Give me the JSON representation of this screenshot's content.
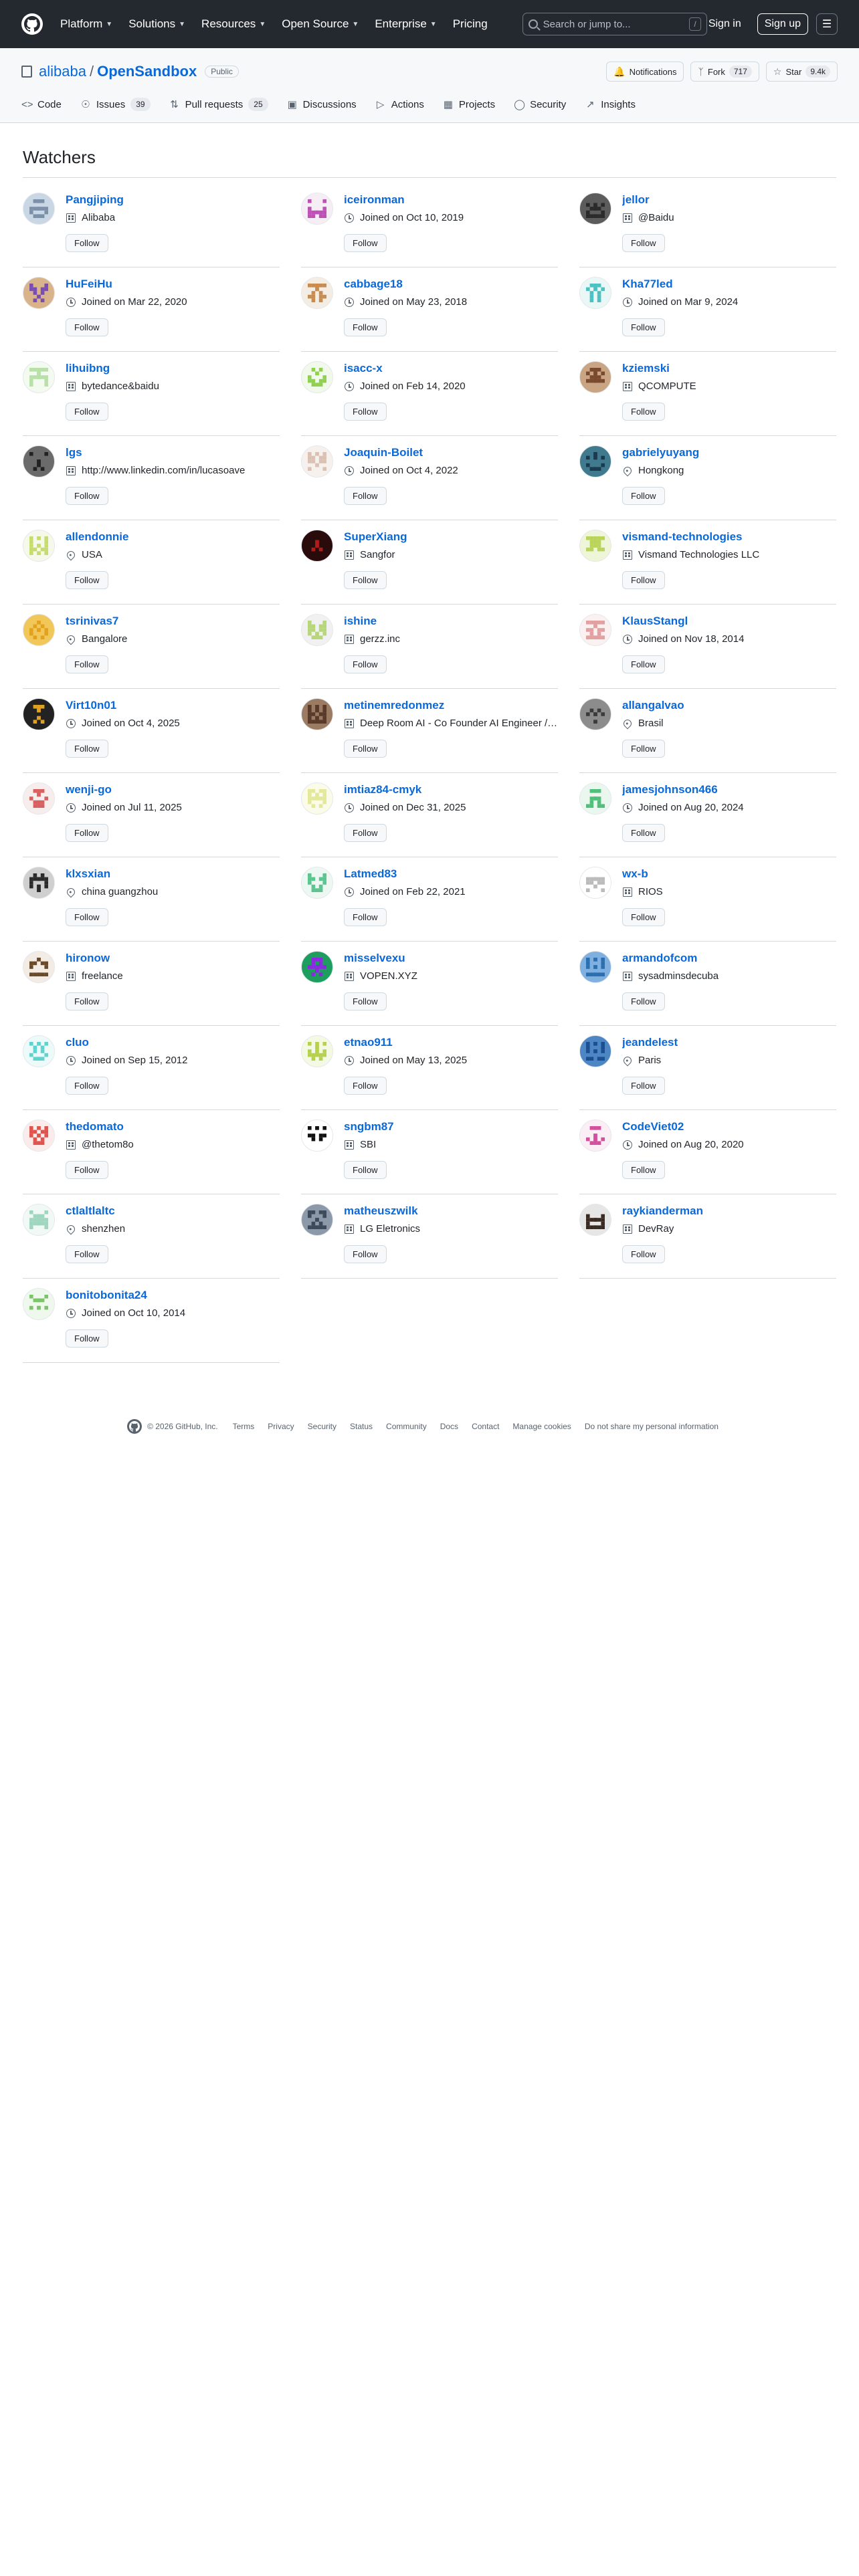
{
  "topnav": {
    "items": [
      "Platform",
      "Solutions",
      "Resources",
      "Open Source",
      "Enterprise",
      "Pricing"
    ],
    "search_placeholder": "Search or jump to...",
    "search_shortcut": "/",
    "signin": "Sign in",
    "signup": "Sign up"
  },
  "repo": {
    "owner": "alibaba",
    "separator": "/",
    "name": "OpenSandbox",
    "visibility": "Public",
    "notifications_label": "Notifications",
    "fork_label": "Fork",
    "fork_count": "717",
    "star_label": "Star",
    "star_count": "9.4k",
    "tabs": [
      {
        "label": "Code",
        "count": ""
      },
      {
        "label": "Issues",
        "count": "39"
      },
      {
        "label": "Pull requests",
        "count": "25"
      },
      {
        "label": "Discussions",
        "count": ""
      },
      {
        "label": "Actions",
        "count": ""
      },
      {
        "label": "Projects",
        "count": ""
      },
      {
        "label": "Security",
        "count": ""
      },
      {
        "label": "Insights",
        "count": ""
      }
    ]
  },
  "page": {
    "title": "Watchers",
    "follow_label": "Follow"
  },
  "watchers": [
    {
      "name": "Pangjiping",
      "meta_type": "org",
      "meta": "Alibaba",
      "color": "#7b8fa8",
      "bg": "#c9d6e4"
    },
    {
      "name": "iceironman",
      "meta_type": "clock",
      "meta": "Joined on Oct 10, 2019",
      "color": "#c04fb8",
      "bg": "#f6eef5"
    },
    {
      "name": "jellor",
      "meta_type": "org",
      "meta": "@Baidu",
      "color": "#2b2b2b",
      "bg": "#5c5c5c"
    },
    {
      "name": "HuFeiHu",
      "meta_type": "clock",
      "meta": "Joined on Mar 22, 2020",
      "color": "#7a4db0",
      "bg": "#d9b48a"
    },
    {
      "name": "cabbage18",
      "meta_type": "clock",
      "meta": "Joined on May 23, 2018",
      "color": "#c98c50",
      "bg": "#f4ede4"
    },
    {
      "name": "Kha77led",
      "meta_type": "clock",
      "meta": "Joined on Mar 9, 2024",
      "color": "#4cc1c1",
      "bg": "#eaf7f7"
    },
    {
      "name": "lihuibng",
      "meta_type": "org",
      "meta": "bytedance&baidu",
      "color": "#b8e0a8",
      "bg": "#f3faf0"
    },
    {
      "name": "isacc-x",
      "meta_type": "clock",
      "meta": "Joined on Feb 14, 2020",
      "color": "#8fd14f",
      "bg": "#f1f9ea"
    },
    {
      "name": "kziemski",
      "meta_type": "org",
      "meta": "QCOMPUTE",
      "color": "#7a4a2e",
      "bg": "#c9a583"
    },
    {
      "name": "lgs",
      "meta_type": "org",
      "meta": "http://www.linkedin.com/in/lucasoave",
      "color": "#222222",
      "bg": "#6b6b6b"
    },
    {
      "name": "Joaquin-Boilet",
      "meta_type": "clock",
      "meta": "Joined on Oct 4, 2022",
      "color": "#d9c2b4",
      "bg": "#f7f1ee"
    },
    {
      "name": "gabrielyuyang",
      "meta_type": "pin",
      "meta": "Hongkong",
      "color": "#1c3a4f",
      "bg": "#3f7a8f"
    },
    {
      "name": "allendonnie",
      "meta_type": "pin",
      "meta": "USA",
      "color": "#c6dc6e",
      "bg": "#f6f9ea"
    },
    {
      "name": "SuperXiang",
      "meta_type": "org",
      "meta": "Sangfor",
      "color": "#b01c1c",
      "bg": "#2a0b0b"
    },
    {
      "name": "vismand-technologies",
      "meta_type": "org",
      "meta": "Vismand Technologies LLC",
      "color": "#b9d45a",
      "bg": "#eef5d9"
    },
    {
      "name": "tsrinivas7",
      "meta_type": "pin",
      "meta": "Bangalore",
      "color": "#e2a21c",
      "bg": "#f2c75a"
    },
    {
      "name": "ishine",
      "meta_type": "org",
      "meta": "gerzz.inc",
      "color": "#b7d67a",
      "bg": "#f1f1f1"
    },
    {
      "name": "KlausStangl",
      "meta_type": "clock",
      "meta": "Joined on Nov 18, 2014",
      "color": "#e3a0a0",
      "bg": "#fbf1f1"
    },
    {
      "name": "Virt10n01",
      "meta_type": "clock",
      "meta": "Joined on Oct 4, 2025",
      "color": "#e0a020",
      "bg": "#222222"
    },
    {
      "name": "metinemredonmez",
      "meta_type": "org",
      "meta": "Deep Room AI - Co Founder AI Engineer / DeepRoom AI Co-Founder",
      "color": "#5a3a2a",
      "bg": "#9b7b62"
    },
    {
      "name": "allangalvao",
      "meta_type": "pin",
      "meta": "Brasil",
      "color": "#3b3b3b",
      "bg": "#8c8c8c"
    },
    {
      "name": "wenji-go",
      "meta_type": "clock",
      "meta": "Joined on Jul 11, 2025",
      "color": "#d96060",
      "bg": "#f8eded"
    },
    {
      "name": "imtiaz84-cmyk",
      "meta_type": "clock",
      "meta": "Joined on Dec 31, 2025",
      "color": "#e3e89a",
      "bg": "#fafbe9"
    },
    {
      "name": "jamesjohnson466",
      "meta_type": "clock",
      "meta": "Joined on Aug 20, 2024",
      "color": "#4fbf7a",
      "bg": "#eaf7ef"
    },
    {
      "name": "klxsxian",
      "meta_type": "pin",
      "meta": "china guangzhou",
      "color": "#2b2b2b",
      "bg": "#cfcfcf"
    },
    {
      "name": "Latmed83",
      "meta_type": "clock",
      "meta": "Joined on Feb 22, 2021",
      "color": "#5cc48e",
      "bg": "#ecf8f1"
    },
    {
      "name": "wx-b",
      "meta_type": "org",
      "meta": "RIOS",
      "color": "#bbbbbb",
      "bg": "#ffffff"
    },
    {
      "name": "hironow",
      "meta_type": "org",
      "meta": "freelance",
      "color": "#6b4a2a",
      "bg": "#f3ece4"
    },
    {
      "name": "misselvexu",
      "meta_type": "org",
      "meta": "VOPEN.XYZ",
      "color": "#8a2be2",
      "bg": "#1e9e5e"
    },
    {
      "name": "armandofcom",
      "meta_type": "org",
      "meta": "sysadminsdecuba",
      "color": "#2a6fb0",
      "bg": "#7fb0e0"
    },
    {
      "name": "cluo",
      "meta_type": "clock",
      "meta": "Joined on Sep 15, 2012",
      "color": "#5ed3cf",
      "bg": "#ecfafa"
    },
    {
      "name": "etnao911",
      "meta_type": "clock",
      "meta": "Joined on May 13, 2025",
      "color": "#b6d24c",
      "bg": "#f4f9e4"
    },
    {
      "name": "jeandelest",
      "meta_type": "pin",
      "meta": "Paris",
      "color": "#1b4f8f",
      "bg": "#4d86c4"
    },
    {
      "name": "thedomato",
      "meta_type": "org",
      "meta": "@thetom8o",
      "color": "#e0544e",
      "bg": "#fbeceb"
    },
    {
      "name": "sngbm87",
      "meta_type": "org",
      "meta": "SBI",
      "color": "#111111",
      "bg": "#ffffff"
    },
    {
      "name": "CodeViet02",
      "meta_type": "clock",
      "meta": "Joined on Aug 20, 2020",
      "color": "#d4509e",
      "bg": "#fbeef5"
    },
    {
      "name": "ctlaltlaltc",
      "meta_type": "pin",
      "meta": "shenzhen",
      "color": "#9fd6c0",
      "bg": "#f1f9f6"
    },
    {
      "name": "matheuszwilk",
      "meta_type": "org",
      "meta": "LG Eletronics",
      "color": "#3c4a5a",
      "bg": "#8c99a8"
    },
    {
      "name": "raykianderman",
      "meta_type": "org",
      "meta": "DevRay",
      "color": "#3a2a22",
      "bg": "#e6e6e6"
    },
    {
      "name": "bonitobonita24",
      "meta_type": "clock",
      "meta": "Joined on Oct 10, 2014",
      "color": "#7bc46a",
      "bg": "#eff8ec"
    }
  ],
  "footer": {
    "copyright": "© 2026 GitHub, Inc.",
    "links": [
      "Terms",
      "Privacy",
      "Security",
      "Status",
      "Community",
      "Docs",
      "Contact",
      "Manage cookies",
      "Do not share my personal information"
    ]
  }
}
